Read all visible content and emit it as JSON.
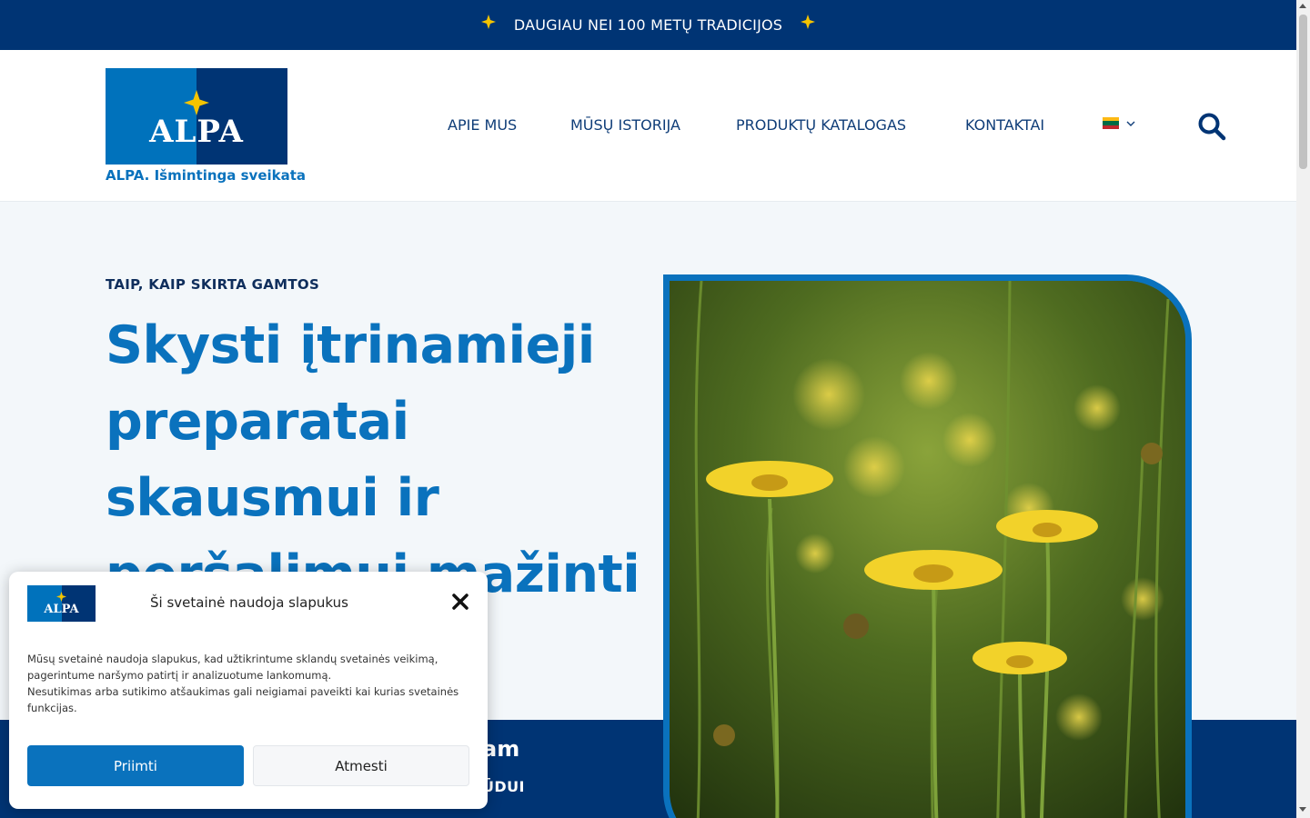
{
  "topbar": {
    "text": "DAUGIAU NEI 100 METŲ TRADICIJOS"
  },
  "header": {
    "logo_text": "ALPA",
    "tagline": "ALPA. Išmintinga sveikata",
    "nav": [
      "APIE MUS",
      "MŪSŲ ISTORIJA",
      "PRODUKTŲ KATALOGAS",
      "KONTAKTAI"
    ],
    "language_flag_colors": [
      "#FDB913",
      "#006A44",
      "#C1272D"
    ]
  },
  "hero": {
    "eyebrow": "TAIP, KAIP SKIRTA GAMTOS",
    "title": "Skysti įtrinamieji preparatai skausmui ir peršalimui mažinti",
    "band_title_fragment": "am",
    "band_sub_fragment": "ŪDUI"
  },
  "cookie": {
    "logo_text": "ALPA",
    "title": "Ši svetainė naudoja slapukus",
    "body_line1": "Mūsų svetainė naudoja slapukus, kad užtikrintume sklandų svetainės veikimą, pagerintume naršymo patirtį ir analizuotume lankomumą.",
    "body_line2": "Nesutikimas arba sutikimo atšaukimas gali neigiamai paveikti kai kurias svetainės funkcijas.",
    "accept_label": "Priimti",
    "reject_label": "Atmesti"
  },
  "colors": {
    "brand_dark": "#003474",
    "brand_blue": "#0A72BD",
    "accent_yellow": "#F5C400"
  },
  "icons": [
    "sparkle-star-icon",
    "sparkle-star-icon",
    "chevron-down-icon",
    "search-icon",
    "close-icon"
  ]
}
